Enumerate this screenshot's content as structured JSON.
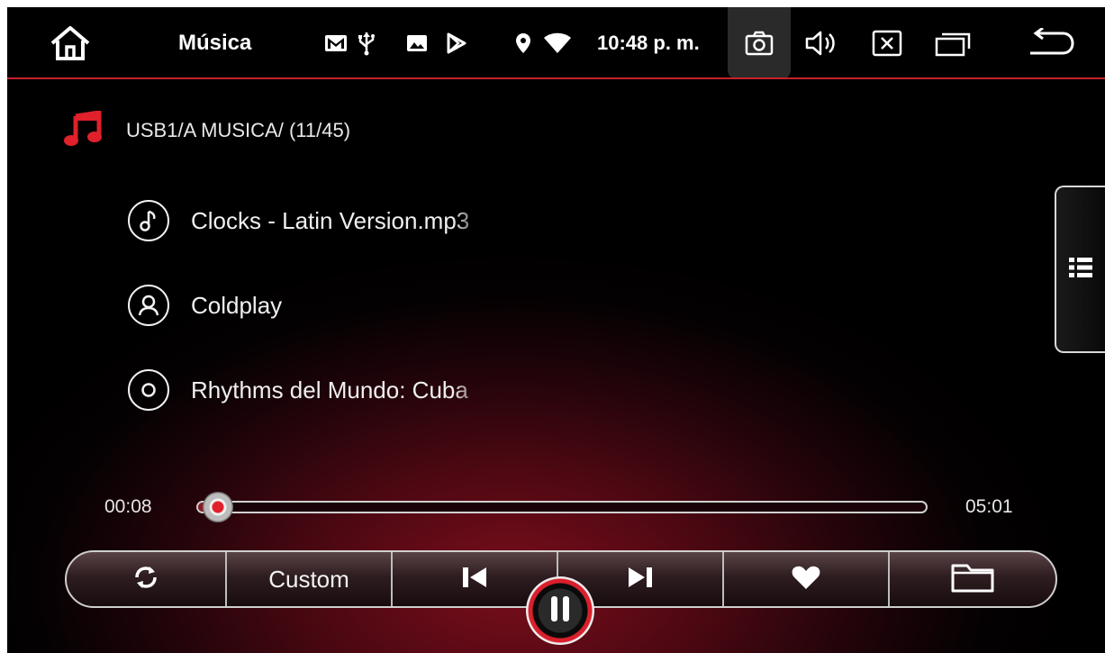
{
  "status_bar": {
    "app_title": "Música",
    "time": "10:48 p. m.",
    "icons": [
      "home-icon",
      "gmail-icon",
      "usb-icon",
      "image-icon",
      "play-store-icon",
      "location-icon",
      "wifi-icon",
      "camera-icon",
      "volume-icon",
      "close-icon",
      "recent-apps-icon",
      "back-icon"
    ]
  },
  "player": {
    "path": "USB1/A MUSICA/ (11/45)",
    "track_title": "Clocks - Latin Version.mp3",
    "artist": "Coldplay",
    "album": "Rhythms del Mundo: Cuba",
    "elapsed": "00:08",
    "duration": "05:01",
    "progress_fraction": 0.027
  },
  "controls": {
    "eq_label": "Custom",
    "buttons": [
      "repeat-icon",
      "eq-custom",
      "previous-icon",
      "pause-icon",
      "next-icon",
      "favorite-icon",
      "folder-icon"
    ]
  },
  "colors": {
    "accent": "#c8202c",
    "background": "#000000",
    "glow": "#7a0e1c"
  }
}
